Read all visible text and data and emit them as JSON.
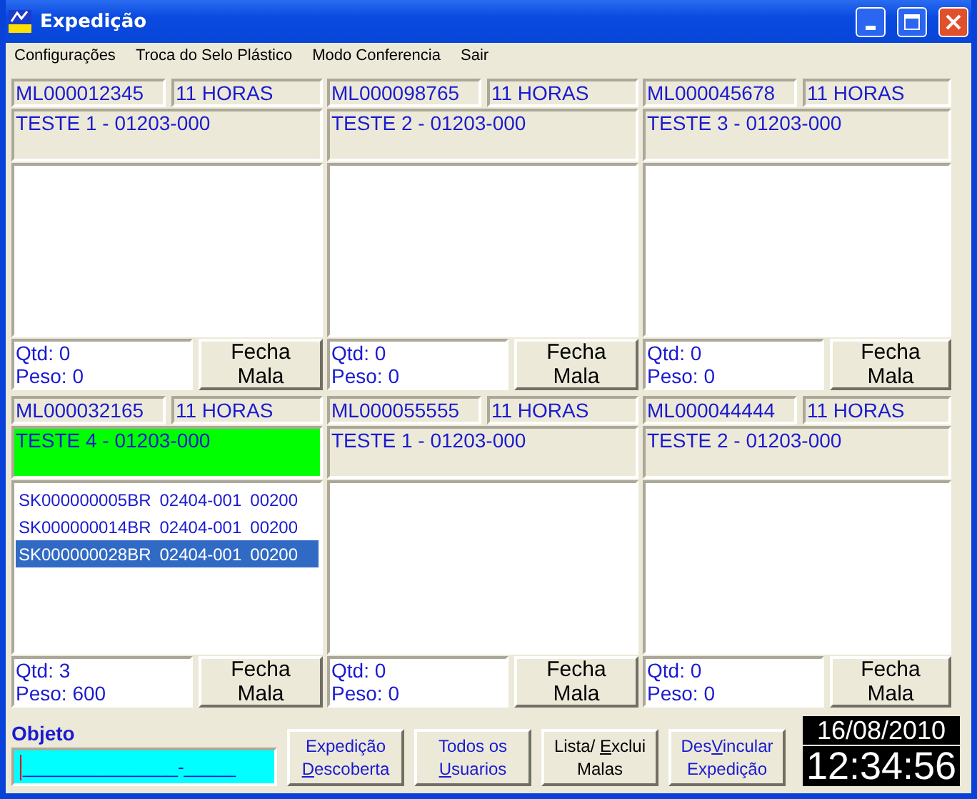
{
  "window": {
    "title": "Expedição"
  },
  "menu": [
    {
      "label": "Configurações"
    },
    {
      "label": "Troca do Selo Plástico"
    },
    {
      "label": "Modo Conferencia"
    },
    {
      "label": "Sair"
    }
  ],
  "panels": [
    {
      "code": "ML000012345",
      "hours": "11 HORAS",
      "name": "TESTE 1 - 01203-000",
      "highlight": false,
      "qtd": "Qtd: 0",
      "peso": "Peso: 0",
      "button": [
        "Fecha",
        "Mala"
      ]
    },
    {
      "code": "ML000098765",
      "hours": "11 HORAS",
      "name": "TESTE 2 - 01203-000",
      "highlight": false,
      "qtd": "Qtd: 0",
      "peso": "Peso: 0",
      "button": [
        "Fecha",
        "Mala"
      ]
    },
    {
      "code": "ML000045678",
      "hours": "11 HORAS",
      "name": "TESTE 3 - 01203-000",
      "highlight": false,
      "qtd": "Qtd: 0",
      "peso": "Peso: 0",
      "button": [
        "Fecha",
        "Mala"
      ]
    },
    {
      "code": "ML000032165",
      "hours": "11 HORAS",
      "name": "TESTE 4 - 01203-000",
      "highlight": true,
      "items": [
        {
          "code": "SK000000005BR",
          "cep": "02404-001",
          "weight": "00200",
          "selected": false
        },
        {
          "code": "SK000000014BR",
          "cep": "02404-001",
          "weight": "00200",
          "selected": false
        },
        {
          "code": "SK000000028BR",
          "cep": "02404-001",
          "weight": "00200",
          "selected": true
        }
      ],
      "qtd": "Qtd: 3",
      "peso": "Peso: 600",
      "button": [
        "Fecha",
        "Mala"
      ]
    },
    {
      "code": "ML000055555",
      "hours": "11 HORAS",
      "name": "TESTE 1 - 01203-000",
      "highlight": false,
      "qtd": "Qtd: 0",
      "peso": "Peso: 0",
      "button": [
        "Fecha",
        "Mala"
      ]
    },
    {
      "code": "ML000044444",
      "hours": "11 HORAS",
      "name": "TESTE 2 - 01203-000",
      "highlight": false,
      "qtd": "Qtd: 0",
      "peso": "Peso: 0",
      "button": [
        "Fecha",
        "Mala"
      ]
    }
  ],
  "objeto": {
    "label": "Objeto",
    "mask": "_______________-_____"
  },
  "buttons": [
    {
      "color": "#1a1ad0",
      "lines": [
        [
          {
            "text": "Expedição",
            "underlined": false
          }
        ],
        [
          {
            "text": "D",
            "underlined": true
          },
          {
            "text": "escoberta",
            "underlined": false
          }
        ]
      ]
    },
    {
      "color": "#1a1ad0",
      "lines": [
        [
          {
            "text": "Todos os",
            "underlined": false
          }
        ],
        [
          {
            "text": "U",
            "underlined": true
          },
          {
            "text": "suarios",
            "underlined": false
          }
        ]
      ]
    },
    {
      "color": "#000000",
      "lines": [
        [
          {
            "text": "Lista/ ",
            "underlined": false
          },
          {
            "text": "E",
            "underlined": true
          },
          {
            "text": "xclui",
            "underlined": false
          }
        ],
        [
          {
            "text": "Malas",
            "underlined": false
          }
        ]
      ]
    },
    {
      "color": "#1a1ad0",
      "lines": [
        [
          {
            "text": "Des",
            "underlined": false
          },
          {
            "text": "V",
            "underlined": true
          },
          {
            "text": "incular",
            "underlined": false
          }
        ],
        [
          {
            "text": "Expedição",
            "underlined": false
          }
        ]
      ]
    }
  ],
  "clock": {
    "date": "16/08/2010",
    "time": "12:34:56"
  }
}
